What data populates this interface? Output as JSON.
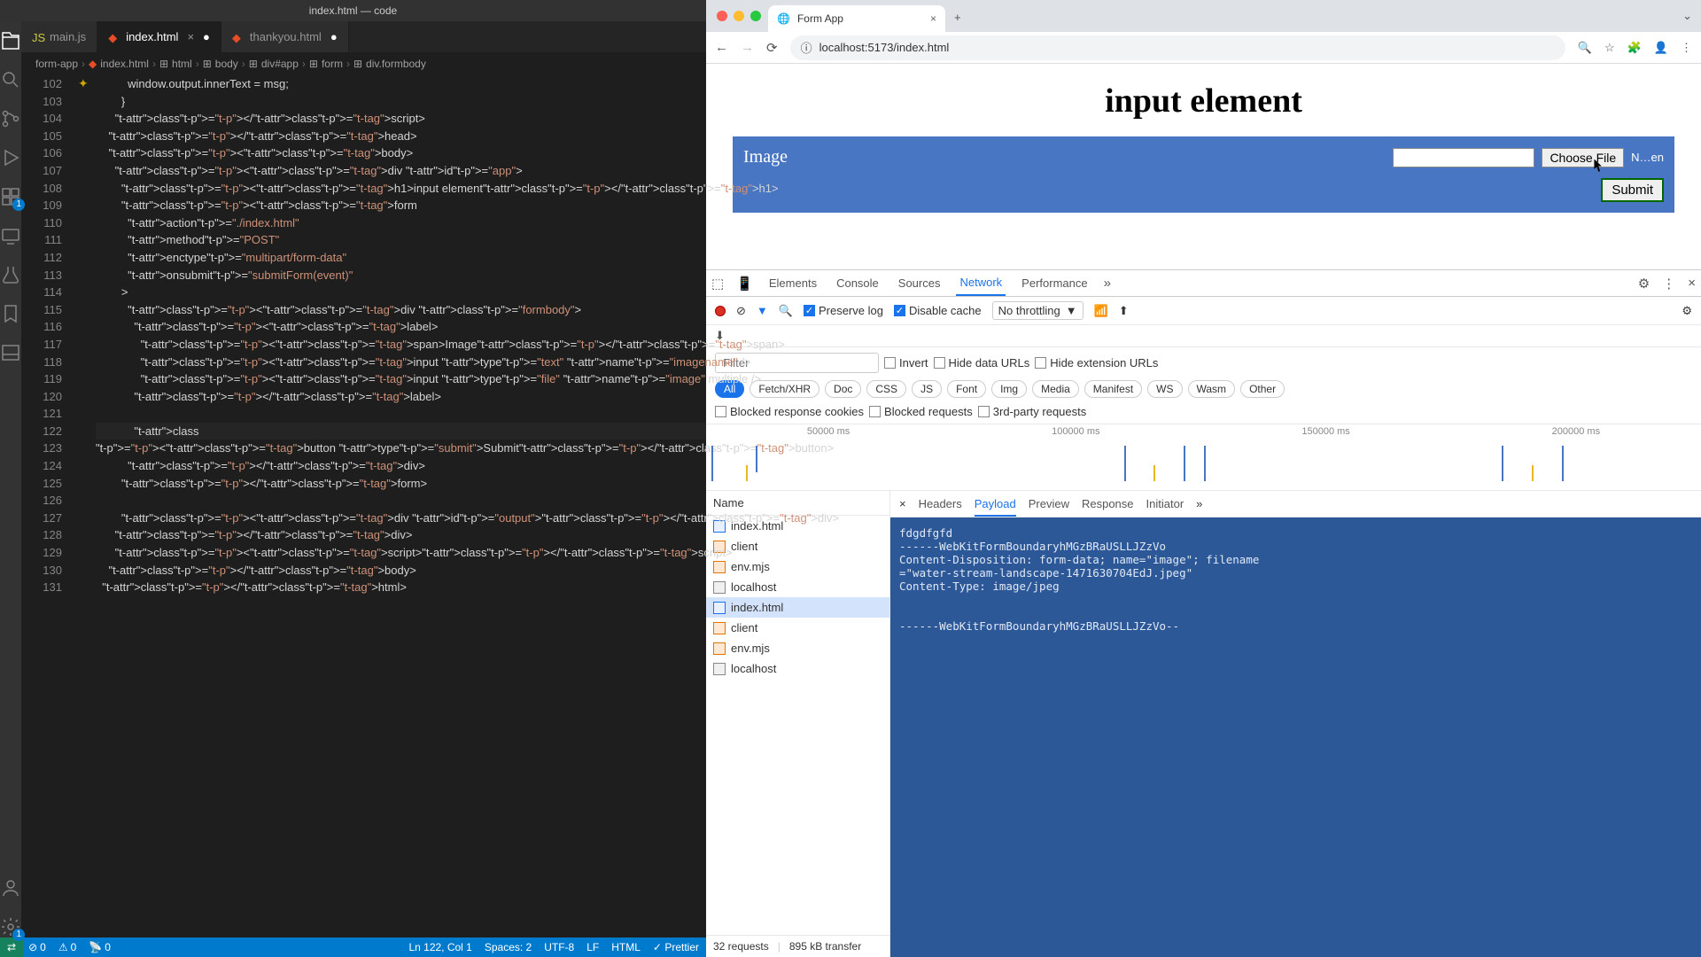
{
  "vscode": {
    "title": "index.html — code",
    "tabs": [
      {
        "label": "main.js",
        "icon": "js"
      },
      {
        "label": "index.html",
        "icon": "html",
        "active": true,
        "dirty": true
      },
      {
        "label": "thankyou.html",
        "icon": "html",
        "dirty": true
      }
    ],
    "breadcrumb": [
      "form-app",
      "index.html",
      "html",
      "body",
      "div#app",
      "form",
      "div.formbody"
    ],
    "code_start_line": 102,
    "status": {
      "errors": "0",
      "warnings": "0",
      "ports": "0",
      "pos": "Ln 122, Col 1",
      "spaces": "Spaces: 2",
      "enc": "UTF-8",
      "eol": "LF",
      "lang": "HTML",
      "fmt": "Prettier"
    },
    "activity_badges": {
      "ext": "1",
      "settings": "1"
    }
  },
  "browser": {
    "tab_title": "Form App",
    "url": "localhost:5173/index.html",
    "page": {
      "heading": "input element",
      "label": "Image",
      "choose": "Choose File",
      "chosen": "N…en",
      "submit": "Submit"
    }
  },
  "devtools": {
    "tabs": [
      "Elements",
      "Console",
      "Sources",
      "Network",
      "Performance"
    ],
    "active_tab": "Network",
    "preserve": "Preserve log",
    "disable_cache": "Disable cache",
    "throttling": "No throttling",
    "filter_placeholder": "Filter",
    "invert": "Invert",
    "hide_urls": "Hide data URLs",
    "hide_ext": "Hide extension URLs",
    "chips": [
      "All",
      "Fetch/XHR",
      "Doc",
      "CSS",
      "JS",
      "Font",
      "Img",
      "Media",
      "Manifest",
      "WS",
      "Wasm",
      "Other"
    ],
    "blocked_cookies": "Blocked response cookies",
    "blocked_req": "Blocked requests",
    "third_party": "3rd-party requests",
    "timeline_marks": [
      "50000 ms",
      "100000 ms",
      "150000 ms",
      "200000 ms"
    ],
    "req_header": "Name",
    "requests": [
      {
        "name": "index.html",
        "type": "doc"
      },
      {
        "name": "client",
        "type": "js"
      },
      {
        "name": "env.mjs",
        "type": "js"
      },
      {
        "name": "localhost",
        "type": "ws"
      },
      {
        "name": "index.html",
        "type": "doc",
        "sel": true
      },
      {
        "name": "client",
        "type": "js"
      },
      {
        "name": "env.mjs",
        "type": "js"
      },
      {
        "name": "localhost",
        "type": "ws"
      }
    ],
    "footer": {
      "reqs": "32 requests",
      "transfer": "895 kB transfer"
    },
    "detail_tabs": [
      "Headers",
      "Payload",
      "Preview",
      "Response",
      "Initiator"
    ],
    "detail_active": "Payload",
    "payload": "fdgdfgfd\n------WebKitFormBoundaryhMGzBRaUSLLJZzVo\nContent-Disposition: form-data; name=\"image\"; filename\n=\"water-stream-landscape-1471630704EdJ.jpeg\"\nContent-Type: image/jpeg\n\n\n------WebKitFormBoundaryhMGzBRaUSLLJZzVo--"
  }
}
